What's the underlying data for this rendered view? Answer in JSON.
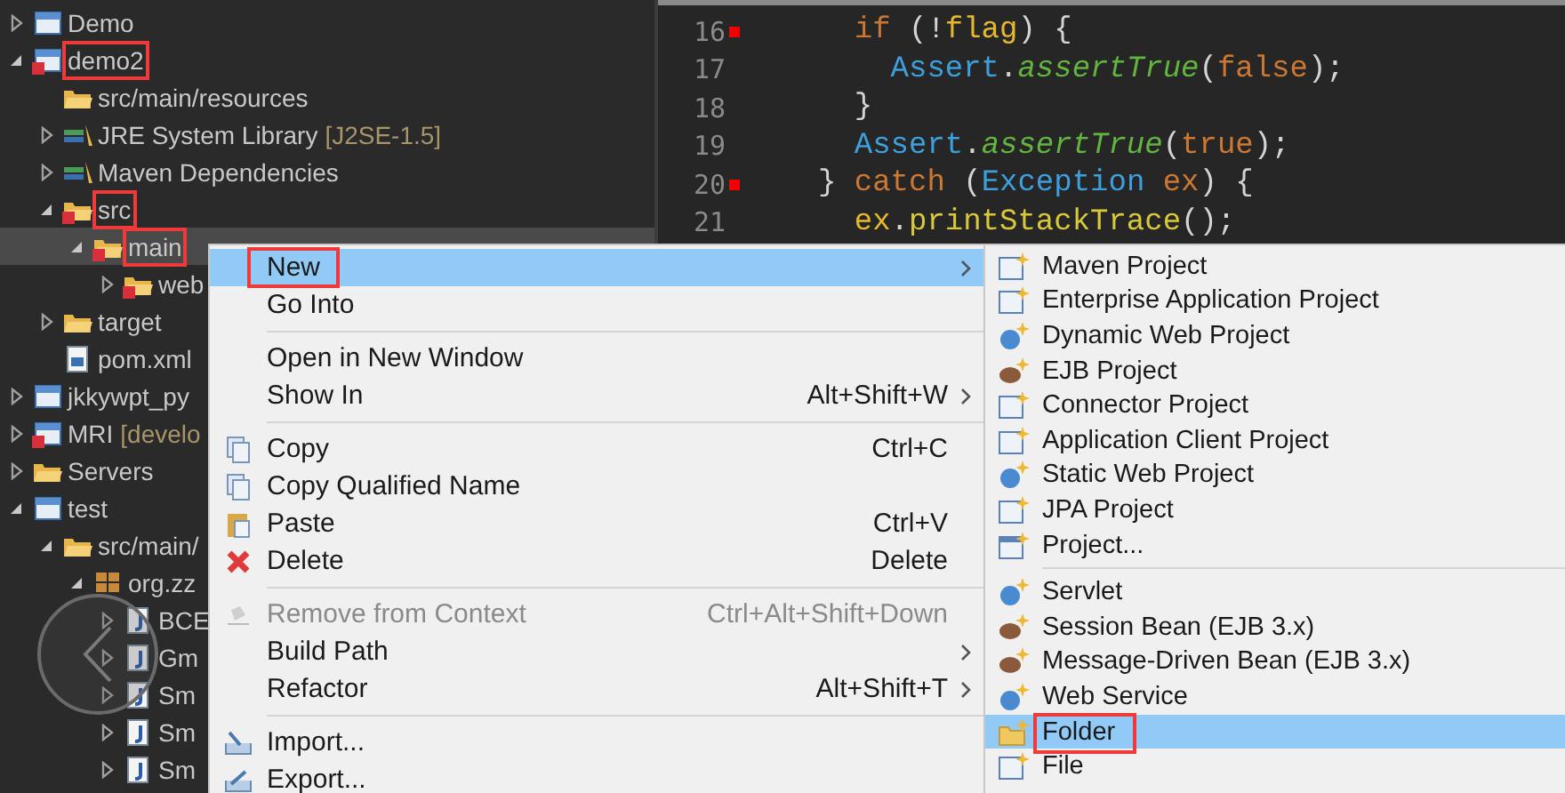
{
  "explorer": {
    "items": [
      {
        "label": "Demo",
        "kind": "project",
        "expanded": false
      },
      {
        "label": "demo2",
        "kind": "project",
        "expanded": true,
        "error": true,
        "highlighted": true,
        "children": [
          {
            "label": "src/main/resources",
            "kind": "source-folder"
          },
          {
            "label": "JRE System Library",
            "decoration": "[J2SE-1.5]",
            "kind": "library",
            "expanded": false
          },
          {
            "label": "Maven Dependencies",
            "kind": "library",
            "expanded": false
          },
          {
            "label": "src",
            "kind": "folder",
            "expanded": true,
            "error": true,
            "highlighted": true,
            "children": [
              {
                "label": "main",
                "kind": "folder",
                "expanded": true,
                "error": true,
                "highlighted": true,
                "selected": true,
                "children": [
                  {
                    "label": "web",
                    "kind": "folder",
                    "expanded": false,
                    "error": true
                  }
                ]
              }
            ]
          },
          {
            "label": "target",
            "kind": "folder",
            "expanded": false
          },
          {
            "label": "pom.xml",
            "kind": "file"
          }
        ]
      },
      {
        "label": "jkkywpt_py",
        "kind": "project",
        "expanded": false
      },
      {
        "label": "MRI",
        "decoration": "[develo",
        "kind": "project",
        "expanded": false,
        "error": true
      },
      {
        "label": "Servers",
        "kind": "source-folder",
        "expanded": false
      },
      {
        "label": "test",
        "kind": "project",
        "expanded": true,
        "children": [
          {
            "label": "src/main/",
            "kind": "source-folder",
            "expanded": true,
            "children": [
              {
                "label": "org.zz",
                "kind": "package",
                "expanded": true,
                "children": [
                  {
                    "label": "BCE",
                    "kind": "java-file",
                    "expanded": false
                  },
                  {
                    "label": "Gm",
                    "kind": "java-file",
                    "expanded": false
                  },
                  {
                    "label": "Sm",
                    "kind": "java-file",
                    "expanded": false
                  },
                  {
                    "label": "Sm",
                    "kind": "java-file",
                    "expanded": false
                  },
                  {
                    "label": "Sm",
                    "kind": "java-file",
                    "expanded": false
                  }
                ]
              }
            ]
          }
        ]
      }
    ]
  },
  "editor": {
    "lines": [
      {
        "number": "16",
        "marker": true,
        "kind": "inner",
        "tokens": [
          {
            "kind": "keyword",
            "text": "if"
          },
          {
            "kind": "plain",
            "text": " (!"
          },
          {
            "kind": "field",
            "text": "flag"
          },
          {
            "kind": "plain",
            "text": ") {"
          }
        ]
      },
      {
        "number": "17",
        "marker": false,
        "kind": "deep",
        "tokens": [
          {
            "kind": "type",
            "text": "Assert"
          },
          {
            "kind": "plain",
            "text": "."
          },
          {
            "kind": "static-method",
            "text": "assertTrue"
          },
          {
            "kind": "plain",
            "text": "("
          },
          {
            "kind": "keyword",
            "text": "false"
          },
          {
            "kind": "plain",
            "text": ");"
          }
        ]
      },
      {
        "number": "18",
        "marker": false,
        "kind": "inner",
        "tokens": [
          {
            "kind": "plain",
            "text": "}"
          }
        ]
      },
      {
        "number": "19",
        "marker": false,
        "kind": "inner",
        "tokens": [
          {
            "kind": "type",
            "text": "Assert"
          },
          {
            "kind": "plain",
            "text": "."
          },
          {
            "kind": "static-method",
            "text": "assertTrue"
          },
          {
            "kind": "plain",
            "text": "("
          },
          {
            "kind": "keyword",
            "text": "true"
          },
          {
            "kind": "plain",
            "text": ");"
          }
        ]
      },
      {
        "number": "20",
        "marker": true,
        "kind": "outer",
        "tokens": [
          {
            "kind": "plain",
            "text": "} "
          },
          {
            "kind": "keyword",
            "text": "catch"
          },
          {
            "kind": "plain",
            "text": " ("
          },
          {
            "kind": "type",
            "text": "Exception "
          },
          {
            "kind": "keyword",
            "text": "ex"
          },
          {
            "kind": "plain",
            "text": ") {"
          }
        ]
      },
      {
        "number": "21",
        "marker": false,
        "kind": "inner",
        "tokens": [
          {
            "kind": "field",
            "text": "ex"
          },
          {
            "kind": "plain",
            "text": "."
          },
          {
            "kind": "method",
            "text": "printStackTrace"
          },
          {
            "kind": "plain",
            "text": "();"
          }
        ]
      }
    ]
  },
  "context_menu": {
    "items": [
      {
        "kind": "item",
        "label": "New",
        "submenu": true,
        "selected": true,
        "highlighted": true
      },
      {
        "kind": "item",
        "label": "Go Into",
        "selected": false
      },
      {
        "kind": "separator"
      },
      {
        "kind": "item",
        "label": "Open in New Window",
        "selected": false
      },
      {
        "kind": "item",
        "label": "Show In",
        "shortcut": "Alt+Shift+W",
        "submenu": true,
        "selected": false
      },
      {
        "kind": "separator"
      },
      {
        "kind": "item",
        "label": "Copy",
        "shortcut": "Ctrl+C",
        "selected": false
      },
      {
        "kind": "item",
        "label": "Copy Qualified Name",
        "selected": false
      },
      {
        "kind": "item",
        "label": "Paste",
        "shortcut": "Ctrl+V",
        "selected": false
      },
      {
        "kind": "item",
        "label": "Delete",
        "shortcut": "Delete",
        "selected": false
      },
      {
        "kind": "separator"
      },
      {
        "kind": "item",
        "label": "Remove from Context",
        "shortcut": "Ctrl+Alt+Shift+Down",
        "disabled": true,
        "selected": false
      },
      {
        "kind": "item",
        "label": "Build Path",
        "submenu": true,
        "selected": false
      },
      {
        "kind": "item",
        "label": "Refactor",
        "shortcut": "Alt+Shift+T",
        "submenu": true,
        "selected": false
      },
      {
        "kind": "separator"
      },
      {
        "kind": "item",
        "label": "Import...",
        "selected": false
      },
      {
        "kind": "item",
        "label": "Export...",
        "selected": false
      }
    ]
  },
  "submenu": {
    "items": [
      {
        "kind": "item",
        "label": "Maven Project",
        "selected": false
      },
      {
        "kind": "item",
        "label": "Enterprise Application Project",
        "selected": false
      },
      {
        "kind": "item",
        "label": "Dynamic Web Project",
        "selected": false
      },
      {
        "kind": "item",
        "label": "EJB Project",
        "selected": false
      },
      {
        "kind": "item",
        "label": "Connector Project",
        "selected": false
      },
      {
        "kind": "item",
        "label": "Application Client Project",
        "selected": false
      },
      {
        "kind": "item",
        "label": "Static Web Project",
        "selected": false
      },
      {
        "kind": "item",
        "label": "JPA Project",
        "selected": false
      },
      {
        "kind": "item",
        "label": "Project...",
        "selected": false
      },
      {
        "kind": "separator"
      },
      {
        "kind": "item",
        "label": "Servlet",
        "selected": false
      },
      {
        "kind": "item",
        "label": "Session Bean (EJB 3.x)",
        "selected": false
      },
      {
        "kind": "item",
        "label": "Message-Driven Bean (EJB 3.x)",
        "selected": false
      },
      {
        "kind": "item",
        "label": "Web Service",
        "selected": false
      },
      {
        "kind": "item",
        "label": "Folder",
        "selected": true,
        "highlighted": true
      },
      {
        "kind": "item",
        "label": "File",
        "selected": false
      }
    ]
  }
}
